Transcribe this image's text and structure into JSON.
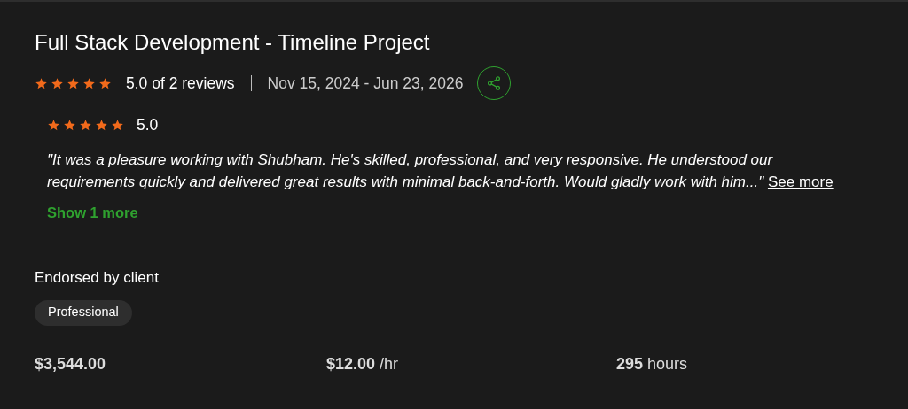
{
  "project": {
    "title": "Full Stack Development - Timeline Project",
    "stars": 5,
    "rating": "5.0 of 2 reviews",
    "dates": "Nov 15, 2024 - Jun 23, 2026"
  },
  "review": {
    "stars": 5,
    "score": "5.0",
    "quote": "\"It was a pleasure working with Shubham. He's skilled, professional, and very responsive. He understood our requirements quickly and delivered great results with minimal back-and-forth. Would gladly work with him...\"",
    "see_more": "See more"
  },
  "show_more": "Show 1 more",
  "endorsement": {
    "heading": "Endorsed by client",
    "tags": [
      "Professional"
    ]
  },
  "stats": [
    {
      "value": "$3,544.00"
    },
    {
      "value": "$12.00",
      "unit": "/hr"
    },
    {
      "value": "295",
      "unit": "hours"
    }
  ]
}
